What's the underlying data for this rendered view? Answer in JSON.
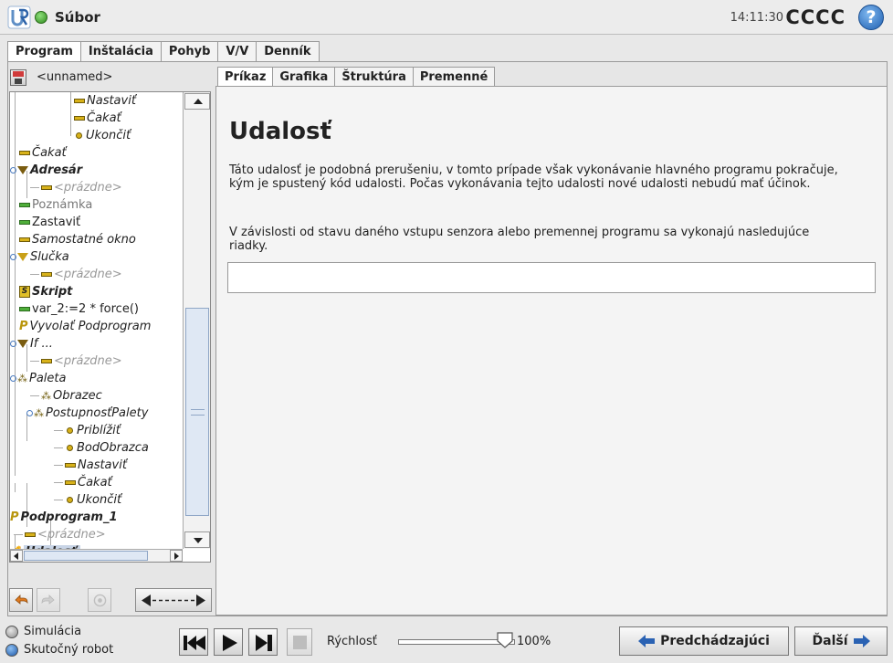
{
  "header": {
    "menu_label": "Súbor",
    "time": "14:11:30",
    "robot_name": "CCCC",
    "help_glyph": "?"
  },
  "main_tabs": [
    {
      "label": "Program",
      "active": true
    },
    {
      "label": "Inštalácia",
      "active": false
    },
    {
      "label": "Pohyb",
      "active": false
    },
    {
      "label": "V/V",
      "active": false
    },
    {
      "label": "Denník",
      "active": false
    }
  ],
  "program": {
    "name": "<unnamed>"
  },
  "tree": [
    {
      "label": "Nastaviť",
      "icon": "set-icon",
      "style": "italic"
    },
    {
      "label": "Čakať",
      "icon": "wait-icon",
      "style": "italic"
    },
    {
      "label": "Ukončiť",
      "icon": "waypoint-icon",
      "style": "italic"
    },
    {
      "label": "Čakať",
      "icon": "wait-icon",
      "style": "italic"
    },
    {
      "label": "Adresár",
      "icon": "folder-icon",
      "style": "bold-italic"
    },
    {
      "label": "<prázdne>",
      "icon": "empty-icon",
      "style": "gray"
    },
    {
      "label": "Poznámka",
      "icon": "comment-icon",
      "style": "normal-gray"
    },
    {
      "label": "Zastaviť",
      "icon": "halt-icon",
      "style": "normal"
    },
    {
      "label": "Samostatné okno",
      "icon": "popup-icon",
      "style": "italic"
    },
    {
      "label": "Slučka",
      "icon": "loop-icon",
      "style": "italic"
    },
    {
      "label": "<prázdne>",
      "icon": "empty-icon",
      "style": "gray"
    },
    {
      "label": "Skript",
      "icon": "script-icon",
      "style": "bold-italic"
    },
    {
      "label": "var_2:=2 * force()",
      "icon": "assignment-icon",
      "style": "normal"
    },
    {
      "label": "Vyvolať Podprogram",
      "icon": "call-icon",
      "style": "italic"
    },
    {
      "label": "If ...",
      "icon": "if-icon",
      "style": "italic"
    },
    {
      "label": "<prázdne>",
      "icon": "empty-icon",
      "style": "gray"
    },
    {
      "label": "Paleta",
      "icon": "pallet-icon",
      "style": "italic"
    },
    {
      "label": "Obrazec",
      "icon": "pattern-icon",
      "style": "italic"
    },
    {
      "label": "PostupnosťPalety",
      "icon": "sequence-icon",
      "style": "italic"
    },
    {
      "label": "Priblížiť",
      "icon": "waypoint-icon",
      "style": "italic"
    },
    {
      "label": "BodObrazca",
      "icon": "waypoint-icon",
      "style": "italic"
    },
    {
      "label": "Nastaviť",
      "icon": "set-icon",
      "style": "italic"
    },
    {
      "label": "Čakať",
      "icon": "wait-icon",
      "style": "italic"
    },
    {
      "label": "Ukončiť",
      "icon": "waypoint-icon",
      "style": "italic"
    },
    {
      "label": "Podprogram_1",
      "icon": "subprogram-icon",
      "style": "bold-italic"
    },
    {
      "label": "<prázdne>",
      "icon": "empty-icon",
      "style": "gray"
    },
    {
      "label": "Udalosť",
      "icon": "event-icon",
      "style": "bold-italic-selected"
    }
  ],
  "sub_tabs": [
    {
      "label": "Príkaz",
      "active": true
    },
    {
      "label": "Grafika",
      "active": false
    },
    {
      "label": "Štruktúra",
      "active": false
    },
    {
      "label": "Premenné",
      "active": false
    }
  ],
  "panel": {
    "title": "Udalosť",
    "description": "Táto udalosť je podobná prerušeniu, v tomto prípade však vykonávanie hlavného programu pokračuje, kým je spustený kód udalosti. Počas vykonávania tejto udalosti nové udalosti nebudú mať účinok.",
    "condition_text": "V závislosti od stavu daného vstupu senzora alebo premennej programu sa vykonajú nasledujúce riadky.",
    "expression_value": ""
  },
  "footer": {
    "mode_simulation": "Simulácia",
    "mode_real": "Skutočný robot",
    "selected_mode": "Skutočný robot",
    "speed_label": "Rýchlosť",
    "speed_value": "100%",
    "speed_fraction": 1.0,
    "prev_label": "Predchádzajúci",
    "next_label": "Ďalší"
  },
  "colors": {
    "accent_blue": "#1f5fb0",
    "status_green": "#2f8a1d",
    "node_yellow": "#d8b21a",
    "selection": "#c8d4e6"
  }
}
